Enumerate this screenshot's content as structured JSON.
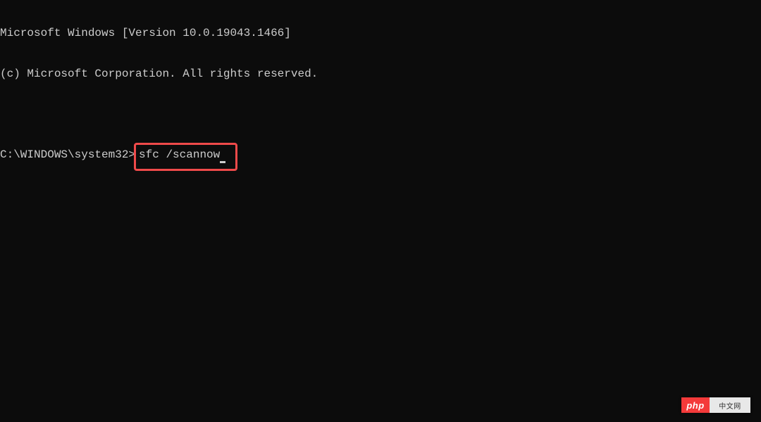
{
  "header": {
    "line1": "Microsoft Windows [Version 10.0.19043.1466]",
    "line2": "(c) Microsoft Corporation. All rights reserved."
  },
  "prompt": {
    "path": "C:\\WINDOWS\\system32>",
    "command": "sfc /scannow"
  },
  "highlight": {
    "border_color": "#ef4a4a"
  },
  "watermark": {
    "left": "php",
    "right": "中文网"
  }
}
